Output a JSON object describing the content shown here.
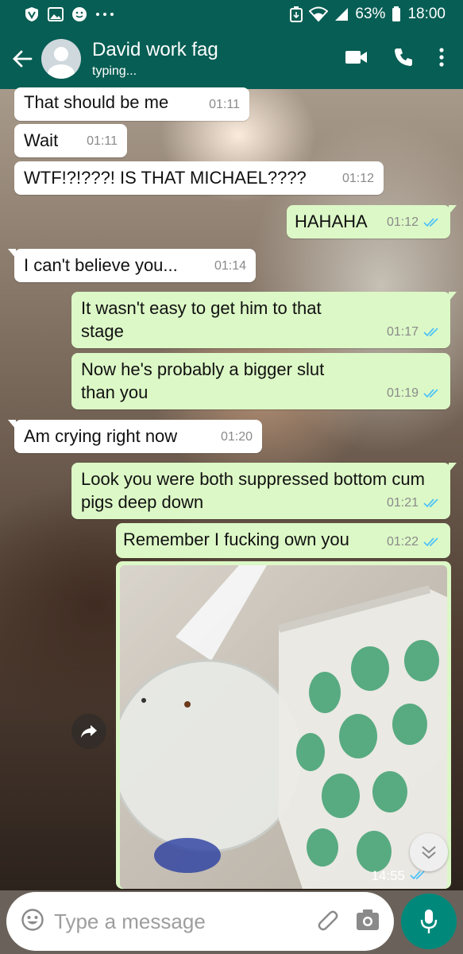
{
  "status_bar": {
    "battery": "63%",
    "time": "18:00",
    "icons": [
      "shield-icon",
      "gallery-icon",
      "smiley-icon",
      "more-dots-icon",
      "data-saver-icon",
      "wifi-icon",
      "signal-icon",
      "battery-icon"
    ]
  },
  "header": {
    "contact_name": "David work fag",
    "status": "typing...",
    "icons": [
      "back-arrow-icon",
      "avatar-icon",
      "video-call-icon",
      "voice-call-icon",
      "more-vert-icon"
    ]
  },
  "messages": [
    {
      "dir": "in",
      "text": "That should be me",
      "time": "01:11"
    },
    {
      "dir": "in",
      "text": "Wait",
      "time": "01:11"
    },
    {
      "dir": "in",
      "text": "WTF!?!???! IS THAT MICHAEL????",
      "time": "01:12"
    },
    {
      "dir": "out",
      "text": "HAHAHA",
      "time": "01:12"
    },
    {
      "dir": "in",
      "text": "I can't believe you...",
      "time": "01:14"
    },
    {
      "dir": "out",
      "text": "It wasn't easy to get him to that stage",
      "time": "01:17"
    },
    {
      "dir": "out",
      "text": "Now he's probably a bigger slut than you",
      "time": "01:19"
    },
    {
      "dir": "in",
      "text": "Am crying right now",
      "time": "01:20"
    },
    {
      "dir": "out",
      "text": "Look you were both suppressed bottom cum pigs deep down",
      "time": "01:21"
    },
    {
      "dir": "out",
      "text": "Remember I fucking own you",
      "time": "01:22"
    }
  ],
  "image_message": {
    "time": "14:55"
  },
  "composer": {
    "placeholder": "Type a message",
    "icons": [
      "emoji-icon",
      "attach-icon",
      "camera-icon",
      "mic-icon"
    ]
  },
  "colors": {
    "header": "#075e54",
    "outgoing_bubble": "#dcf8c6",
    "incoming_bubble": "#ffffff",
    "read_ticks": "#4fc3f7",
    "mic_button": "#00897b"
  }
}
